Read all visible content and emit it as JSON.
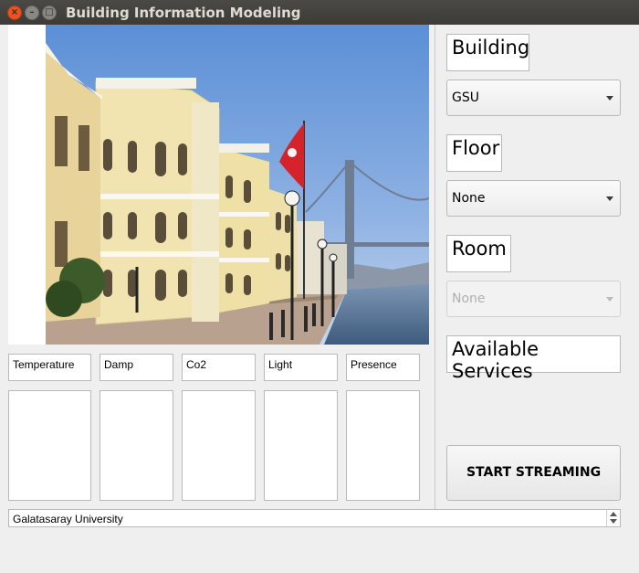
{
  "window": {
    "title": "Building Information Modeling"
  },
  "building": {
    "label": "Building",
    "selected": "GSU"
  },
  "floor": {
    "label": "Floor",
    "selected": "None"
  },
  "room": {
    "label": "Room",
    "selected": "None"
  },
  "services": {
    "label": "Available Services"
  },
  "sensors": [
    {
      "label": "Temperature"
    },
    {
      "label": "Damp"
    },
    {
      "label": "Co2"
    },
    {
      "label": "Light"
    },
    {
      "label": "Presence"
    }
  ],
  "start_button": {
    "label": "START STREAMING"
  },
  "status": {
    "value": "Galatasaray University"
  }
}
